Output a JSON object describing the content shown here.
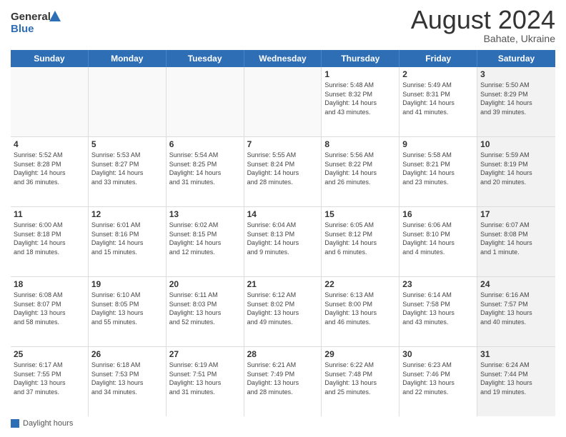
{
  "logo": {
    "line1": "General",
    "line2": "Blue"
  },
  "title": "August 2024",
  "location": "Bahate, Ukraine",
  "days_of_week": [
    "Sunday",
    "Monday",
    "Tuesday",
    "Wednesday",
    "Thursday",
    "Friday",
    "Saturday"
  ],
  "footer": {
    "label": "Daylight hours"
  },
  "rows": [
    [
      {
        "day": "",
        "info": "",
        "empty": true
      },
      {
        "day": "",
        "info": "",
        "empty": true
      },
      {
        "day": "",
        "info": "",
        "empty": true
      },
      {
        "day": "",
        "info": "",
        "empty": true
      },
      {
        "day": "1",
        "info": "Sunrise: 5:48 AM\nSunset: 8:32 PM\nDaylight: 14 hours\nand 43 minutes."
      },
      {
        "day": "2",
        "info": "Sunrise: 5:49 AM\nSunset: 8:31 PM\nDaylight: 14 hours\nand 41 minutes."
      },
      {
        "day": "3",
        "info": "Sunrise: 5:50 AM\nSunset: 8:29 PM\nDaylight: 14 hours\nand 39 minutes.",
        "shaded": true
      }
    ],
    [
      {
        "day": "4",
        "info": "Sunrise: 5:52 AM\nSunset: 8:28 PM\nDaylight: 14 hours\nand 36 minutes."
      },
      {
        "day": "5",
        "info": "Sunrise: 5:53 AM\nSunset: 8:27 PM\nDaylight: 14 hours\nand 33 minutes."
      },
      {
        "day": "6",
        "info": "Sunrise: 5:54 AM\nSunset: 8:25 PM\nDaylight: 14 hours\nand 31 minutes."
      },
      {
        "day": "7",
        "info": "Sunrise: 5:55 AM\nSunset: 8:24 PM\nDaylight: 14 hours\nand 28 minutes."
      },
      {
        "day": "8",
        "info": "Sunrise: 5:56 AM\nSunset: 8:22 PM\nDaylight: 14 hours\nand 26 minutes."
      },
      {
        "day": "9",
        "info": "Sunrise: 5:58 AM\nSunset: 8:21 PM\nDaylight: 14 hours\nand 23 minutes."
      },
      {
        "day": "10",
        "info": "Sunrise: 5:59 AM\nSunset: 8:19 PM\nDaylight: 14 hours\nand 20 minutes.",
        "shaded": true
      }
    ],
    [
      {
        "day": "11",
        "info": "Sunrise: 6:00 AM\nSunset: 8:18 PM\nDaylight: 14 hours\nand 18 minutes."
      },
      {
        "day": "12",
        "info": "Sunrise: 6:01 AM\nSunset: 8:16 PM\nDaylight: 14 hours\nand 15 minutes."
      },
      {
        "day": "13",
        "info": "Sunrise: 6:02 AM\nSunset: 8:15 PM\nDaylight: 14 hours\nand 12 minutes."
      },
      {
        "day": "14",
        "info": "Sunrise: 6:04 AM\nSunset: 8:13 PM\nDaylight: 14 hours\nand 9 minutes."
      },
      {
        "day": "15",
        "info": "Sunrise: 6:05 AM\nSunset: 8:12 PM\nDaylight: 14 hours\nand 6 minutes."
      },
      {
        "day": "16",
        "info": "Sunrise: 6:06 AM\nSunset: 8:10 PM\nDaylight: 14 hours\nand 4 minutes."
      },
      {
        "day": "17",
        "info": "Sunrise: 6:07 AM\nSunset: 8:08 PM\nDaylight: 14 hours\nand 1 minute.",
        "shaded": true
      }
    ],
    [
      {
        "day": "18",
        "info": "Sunrise: 6:08 AM\nSunset: 8:07 PM\nDaylight: 13 hours\nand 58 minutes."
      },
      {
        "day": "19",
        "info": "Sunrise: 6:10 AM\nSunset: 8:05 PM\nDaylight: 13 hours\nand 55 minutes."
      },
      {
        "day": "20",
        "info": "Sunrise: 6:11 AM\nSunset: 8:03 PM\nDaylight: 13 hours\nand 52 minutes."
      },
      {
        "day": "21",
        "info": "Sunrise: 6:12 AM\nSunset: 8:02 PM\nDaylight: 13 hours\nand 49 minutes."
      },
      {
        "day": "22",
        "info": "Sunrise: 6:13 AM\nSunset: 8:00 PM\nDaylight: 13 hours\nand 46 minutes."
      },
      {
        "day": "23",
        "info": "Sunrise: 6:14 AM\nSunset: 7:58 PM\nDaylight: 13 hours\nand 43 minutes."
      },
      {
        "day": "24",
        "info": "Sunrise: 6:16 AM\nSunset: 7:57 PM\nDaylight: 13 hours\nand 40 minutes.",
        "shaded": true
      }
    ],
    [
      {
        "day": "25",
        "info": "Sunrise: 6:17 AM\nSunset: 7:55 PM\nDaylight: 13 hours\nand 37 minutes."
      },
      {
        "day": "26",
        "info": "Sunrise: 6:18 AM\nSunset: 7:53 PM\nDaylight: 13 hours\nand 34 minutes."
      },
      {
        "day": "27",
        "info": "Sunrise: 6:19 AM\nSunset: 7:51 PM\nDaylight: 13 hours\nand 31 minutes."
      },
      {
        "day": "28",
        "info": "Sunrise: 6:21 AM\nSunset: 7:49 PM\nDaylight: 13 hours\nand 28 minutes."
      },
      {
        "day": "29",
        "info": "Sunrise: 6:22 AM\nSunset: 7:48 PM\nDaylight: 13 hours\nand 25 minutes."
      },
      {
        "day": "30",
        "info": "Sunrise: 6:23 AM\nSunset: 7:46 PM\nDaylight: 13 hours\nand 22 minutes."
      },
      {
        "day": "31",
        "info": "Sunrise: 6:24 AM\nSunset: 7:44 PM\nDaylight: 13 hours\nand 19 minutes.",
        "shaded": true
      }
    ]
  ]
}
